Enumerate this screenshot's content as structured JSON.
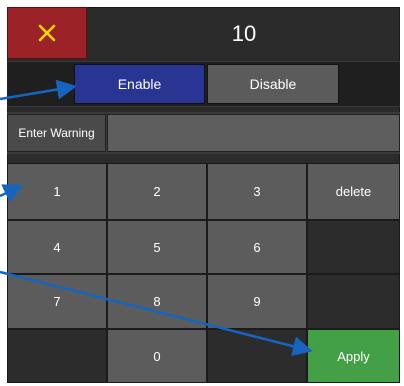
{
  "header": {
    "close_icon": "close-icon",
    "value": "10"
  },
  "toggle": {
    "enable_label": "Enable",
    "disable_label": "Disable",
    "selected": "Enable"
  },
  "warning": {
    "label": "Enter Warning",
    "value": ""
  },
  "keypad": {
    "k1": "1",
    "k2": "2",
    "k3": "3",
    "delete": "delete",
    "k4": "4",
    "k5": "5",
    "k6": "6",
    "k7": "7",
    "k8": "8",
    "k9": "9",
    "k0": "0",
    "apply": "Apply"
  },
  "colors": {
    "close": "#9b2226",
    "enable_selected": "#283593",
    "apply": "#43a047",
    "annotation_arrow": "#1565c0"
  }
}
